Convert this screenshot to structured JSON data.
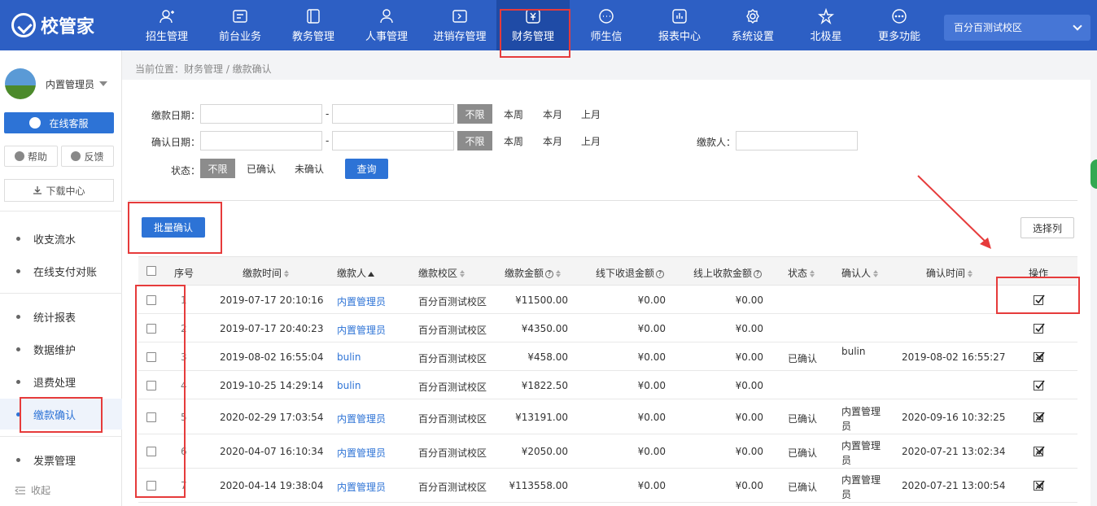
{
  "app": {
    "logo": "校管家"
  },
  "nav": [
    {
      "label": "招生管理",
      "icon": "user-plus-icon"
    },
    {
      "label": "前台业务",
      "icon": "card-icon"
    },
    {
      "label": "教务管理",
      "icon": "book-icon"
    },
    {
      "label": "人事管理",
      "icon": "person-icon"
    },
    {
      "label": "进销存管理",
      "icon": "inventory-icon"
    },
    {
      "label": "财务管理",
      "icon": "yen-icon"
    },
    {
      "label": "师生信",
      "icon": "message-icon"
    },
    {
      "label": "报表中心",
      "icon": "report-icon"
    },
    {
      "label": "系统设置",
      "icon": "gear-icon"
    },
    {
      "label": "北极星",
      "icon": "star-icon"
    },
    {
      "label": "更多功能",
      "icon": "more-icon"
    }
  ],
  "campus": "百分百测试校区",
  "sidebar": {
    "user": "内置管理员",
    "service": "在线客服",
    "help": "帮助",
    "feedback": "反馈",
    "download": "下载中心",
    "items": [
      "收支流水",
      "在线支付对账",
      "统计报表",
      "数据维护",
      "退费处理",
      "缴款确认",
      "发票管理"
    ],
    "collapse": "收起"
  },
  "breadcrumb": "当前位置：财务管理 / 缴款确认",
  "filters": {
    "pay_date": "缴款日期：",
    "confirm_date": "确认日期：",
    "dash": "-",
    "unlimited": "不限",
    "this_week": "本周",
    "this_month": "本月",
    "last_month": "上月",
    "payer": "缴款人：",
    "status": "状态：",
    "confirmed": "已确认",
    "unconfirmed": "未确认",
    "query": "查询"
  },
  "batch_confirm": "批量确认",
  "select_columns": "选择列",
  "table": {
    "headers": [
      "序号",
      "缴款时间",
      "缴款人",
      "缴款校区",
      "缴款金额",
      "线下收退金额",
      "线上收款金额",
      "状态",
      "确认人",
      "确认时间",
      "操作"
    ],
    "rows": [
      {
        "no": "1",
        "time": "2019-07-17 20:10:16",
        "payer": "内置管理员",
        "campus": "百分百测试校区",
        "amount": "¥11500.00",
        "offline": "¥0.00",
        "online": "¥0.00",
        "status": "",
        "confirmer": "",
        "confirm_time": "",
        "op": "check"
      },
      {
        "no": "2",
        "time": "2019-07-17 20:40:23",
        "payer": "内置管理员",
        "campus": "百分百测试校区",
        "amount": "¥4350.00",
        "offline": "¥0.00",
        "online": "¥0.00",
        "status": "",
        "confirmer": "",
        "confirm_time": "",
        "op": "check"
      },
      {
        "no": "3",
        "time": "2019-08-02 16:55:04",
        "payer": "bulin",
        "campus": "百分百测试校区",
        "amount": "¥458.00",
        "offline": "¥0.00",
        "online": "¥0.00",
        "status": "已确认",
        "confirmer": "bulin",
        "confirm_time": "2019-08-02 16:55:27",
        "op": "cancel"
      },
      {
        "no": "4",
        "time": "2019-10-25 14:29:14",
        "payer": "bulin",
        "campus": "百分百测试校区",
        "amount": "¥1822.50",
        "offline": "¥0.00",
        "online": "¥0.00",
        "status": "",
        "confirmer": "",
        "confirm_time": "",
        "op": "check"
      },
      {
        "no": "5",
        "time": "2020-02-29 17:03:54",
        "payer": "内置管理员",
        "campus": "百分百测试校区",
        "amount": "¥13191.00",
        "offline": "¥0.00",
        "online": "¥0.00",
        "status": "已确认",
        "confirmer": "内置管理员",
        "confirm_time": "2020-09-16 10:32:25",
        "op": "cancel"
      },
      {
        "no": "6",
        "time": "2020-04-07 16:10:34",
        "payer": "内置管理员",
        "campus": "百分百测试校区",
        "amount": "¥2050.00",
        "offline": "¥0.00",
        "online": "¥0.00",
        "status": "已确认",
        "confirmer": "内置管理员",
        "confirm_time": "2020-07-21 13:02:34",
        "op": "cancel"
      },
      {
        "no": "7",
        "time": "2020-04-14 19:38:04",
        "payer": "内置管理员",
        "campus": "百分百测试校区",
        "amount": "¥113558.00",
        "offline": "¥0.00",
        "online": "¥0.00",
        "status": "已确认",
        "confirmer": "内置管理员",
        "confirm_time": "2020-07-21 13:00:54",
        "op": "cancel"
      }
    ]
  },
  "colors": {
    "topbar": "#2d5fc4",
    "accent": "#2d73d6",
    "highlight": "#e63b3b"
  }
}
